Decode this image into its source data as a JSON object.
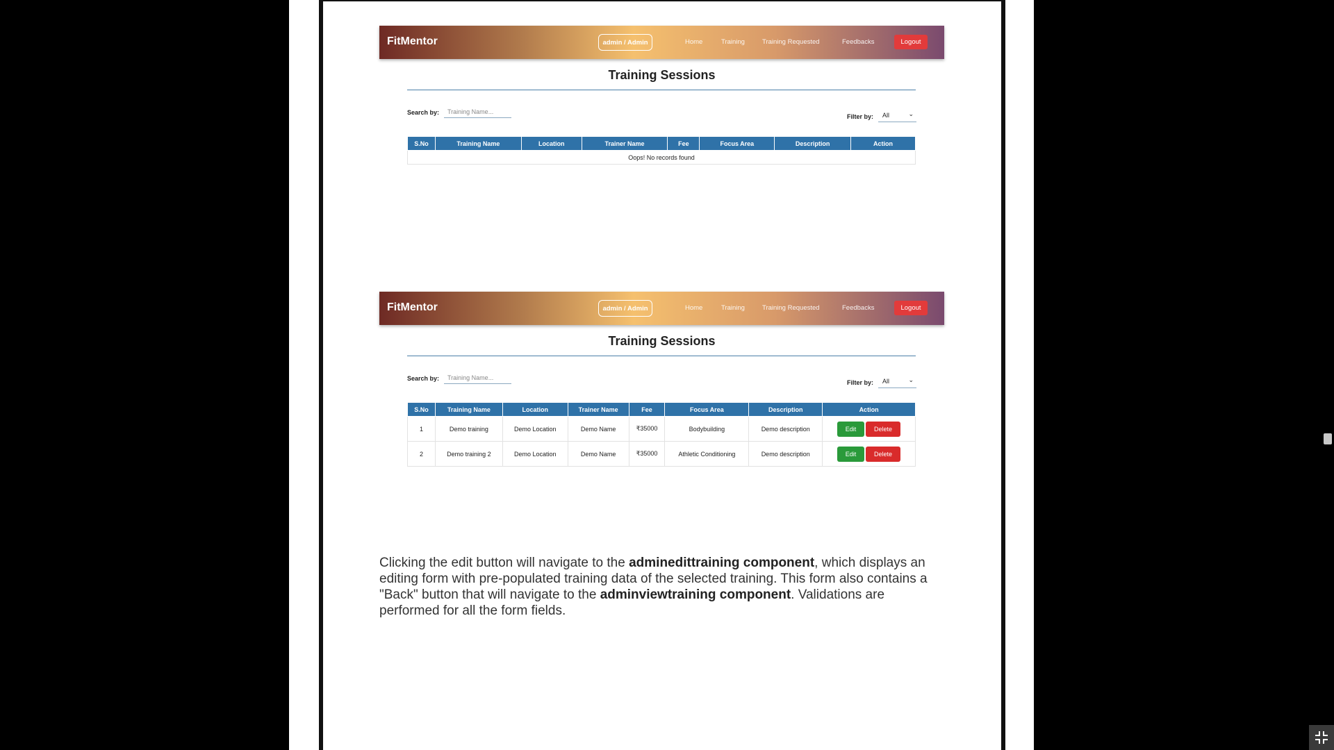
{
  "navbar": {
    "brand": "FitMentor",
    "role": "admin / Admin",
    "links": [
      "Home",
      "Training",
      "Training Requested",
      "Feedbacks"
    ],
    "logout": "Logout"
  },
  "screens": [
    {
      "title": "Training Sessions",
      "search_label": "Search by:",
      "search_placeholder": "Training Name...",
      "filter_label": "Filter by:",
      "filter_value": "All",
      "columns": [
        "S.No",
        "Training Name",
        "Location",
        "Trainer Name",
        "Fee",
        "Focus Area",
        "Description",
        "Action"
      ],
      "empty_message": "Oops! No records found"
    },
    {
      "title": "Training Sessions",
      "search_label": "Search by:",
      "search_placeholder": "Training Name...",
      "filter_label": "Filter by:",
      "filter_value": "All",
      "columns": [
        "S.No",
        "Training Name",
        "Location",
        "Trainer Name",
        "Fee",
        "Focus Area",
        "Description",
        "Action"
      ],
      "rows": [
        {
          "sno": "1",
          "name": "Demo training",
          "location": "Demo Location",
          "trainer": "Demo Name",
          "fee": "₹35000",
          "focus": "Bodybuilding",
          "description": "Demo description",
          "edit": "Edit",
          "delete": "Delete"
        },
        {
          "sno": "2",
          "name": "Demo training 2",
          "location": "Demo Location",
          "trainer": "Demo Name",
          "fee": "₹35000",
          "focus": "Athletic Conditioning",
          "description": "Demo description",
          "edit": "Edit",
          "delete": "Delete"
        }
      ]
    }
  ],
  "paragraph": {
    "part1": "Clicking the edit button will navigate to the ",
    "bold1": "adminedittraining component",
    "part2": ", which displays an editing form with pre-populated training data of the selected training. This form also contains a \"Back\" button that will navigate to the ",
    "bold2": "adminviewtraining component",
    "part3": ". Validations are performed for all the form fields."
  },
  "icons": {
    "collapse": "exit-fullscreen-icon",
    "dropdown": "chevron-down-icon"
  }
}
